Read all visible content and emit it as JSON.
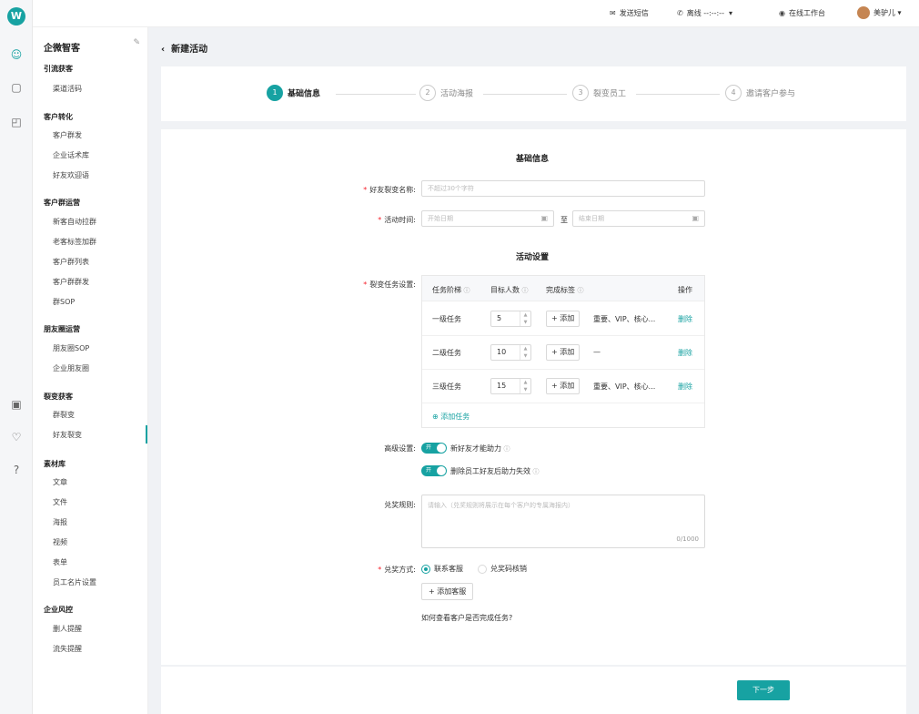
{
  "topbar": {
    "sms": "发送短信",
    "phone_status": "离线 --:--:--",
    "workspace": "在线工作台",
    "user": "美驴儿"
  },
  "sidebar": {
    "app_title": "企微智客",
    "groups": [
      {
        "title": "引流获客",
        "items": [
          "渠道活码"
        ]
      },
      {
        "title": "客户转化",
        "items": [
          "客户群发",
          "企业话术库",
          "好友欢迎语"
        ]
      },
      {
        "title": "客户群运营",
        "items": [
          "新客自动拉群",
          "老客标签加群",
          "客户群列表",
          "客户群群发",
          "群SOP"
        ]
      },
      {
        "title": "朋友圈运营",
        "items": [
          "朋友圈SOP",
          "企业朋友圈"
        ]
      },
      {
        "title": "裂变获客",
        "items": [
          "群裂变",
          "好友裂变"
        ]
      },
      {
        "title": "素材库",
        "items": [
          "文章",
          "文件",
          "海报",
          "视频",
          "表单",
          "员工名片设置"
        ]
      },
      {
        "title": "企业风控",
        "items": [
          "删人提醒",
          "流失提醒"
        ]
      }
    ],
    "active": "好友裂变"
  },
  "page": {
    "back_title": "新建活动"
  },
  "steps": [
    {
      "num": "1",
      "label": "基础信息"
    },
    {
      "num": "2",
      "label": "活动海报"
    },
    {
      "num": "3",
      "label": "裂变员工"
    },
    {
      "num": "4",
      "label": "邀请客户参与"
    }
  ],
  "basic": {
    "section": "基础信息",
    "name_label": "好友裂变名称:",
    "name_placeholder": "不超过30个字符",
    "time_label": "活动时间:",
    "start_placeholder": "开始日期",
    "to": "至",
    "end_placeholder": "结束日期"
  },
  "settings": {
    "section": "活动设置",
    "task_label": "裂变任务设置:",
    "columns": [
      "任务阶梯",
      "目标人数",
      "完成标签",
      "操作"
    ],
    "rows": [
      {
        "name": "一级任务",
        "target": "5",
        "add": "添加",
        "tags": "重要、VIP、核心...",
        "action": "删除"
      },
      {
        "name": "二级任务",
        "target": "10",
        "add": "添加",
        "tags": "—",
        "action": "删除"
      },
      {
        "name": "三级任务",
        "target": "15",
        "add": "添加",
        "tags": "重要、VIP、核心...",
        "action": "删除"
      }
    ],
    "add_task": "添加任务",
    "advanced_label": "高级设置:",
    "toggle_on": "开",
    "toggle1": "新好友才能助力",
    "toggle2": "删除员工好友后助力失效",
    "rule_label": "兑奖规则:",
    "rule_placeholder": "请输入（兑奖规则将展示在每个客户的专属海报内）",
    "rule_count": "0/1000",
    "method_label": "兑奖方式:",
    "method_opt1": "联系客服",
    "method_opt2": "兑奖码核销",
    "add_cs": "添加客服",
    "help_link": "如何查看客户是否完成任务?"
  },
  "footer": {
    "next": "下一步"
  }
}
